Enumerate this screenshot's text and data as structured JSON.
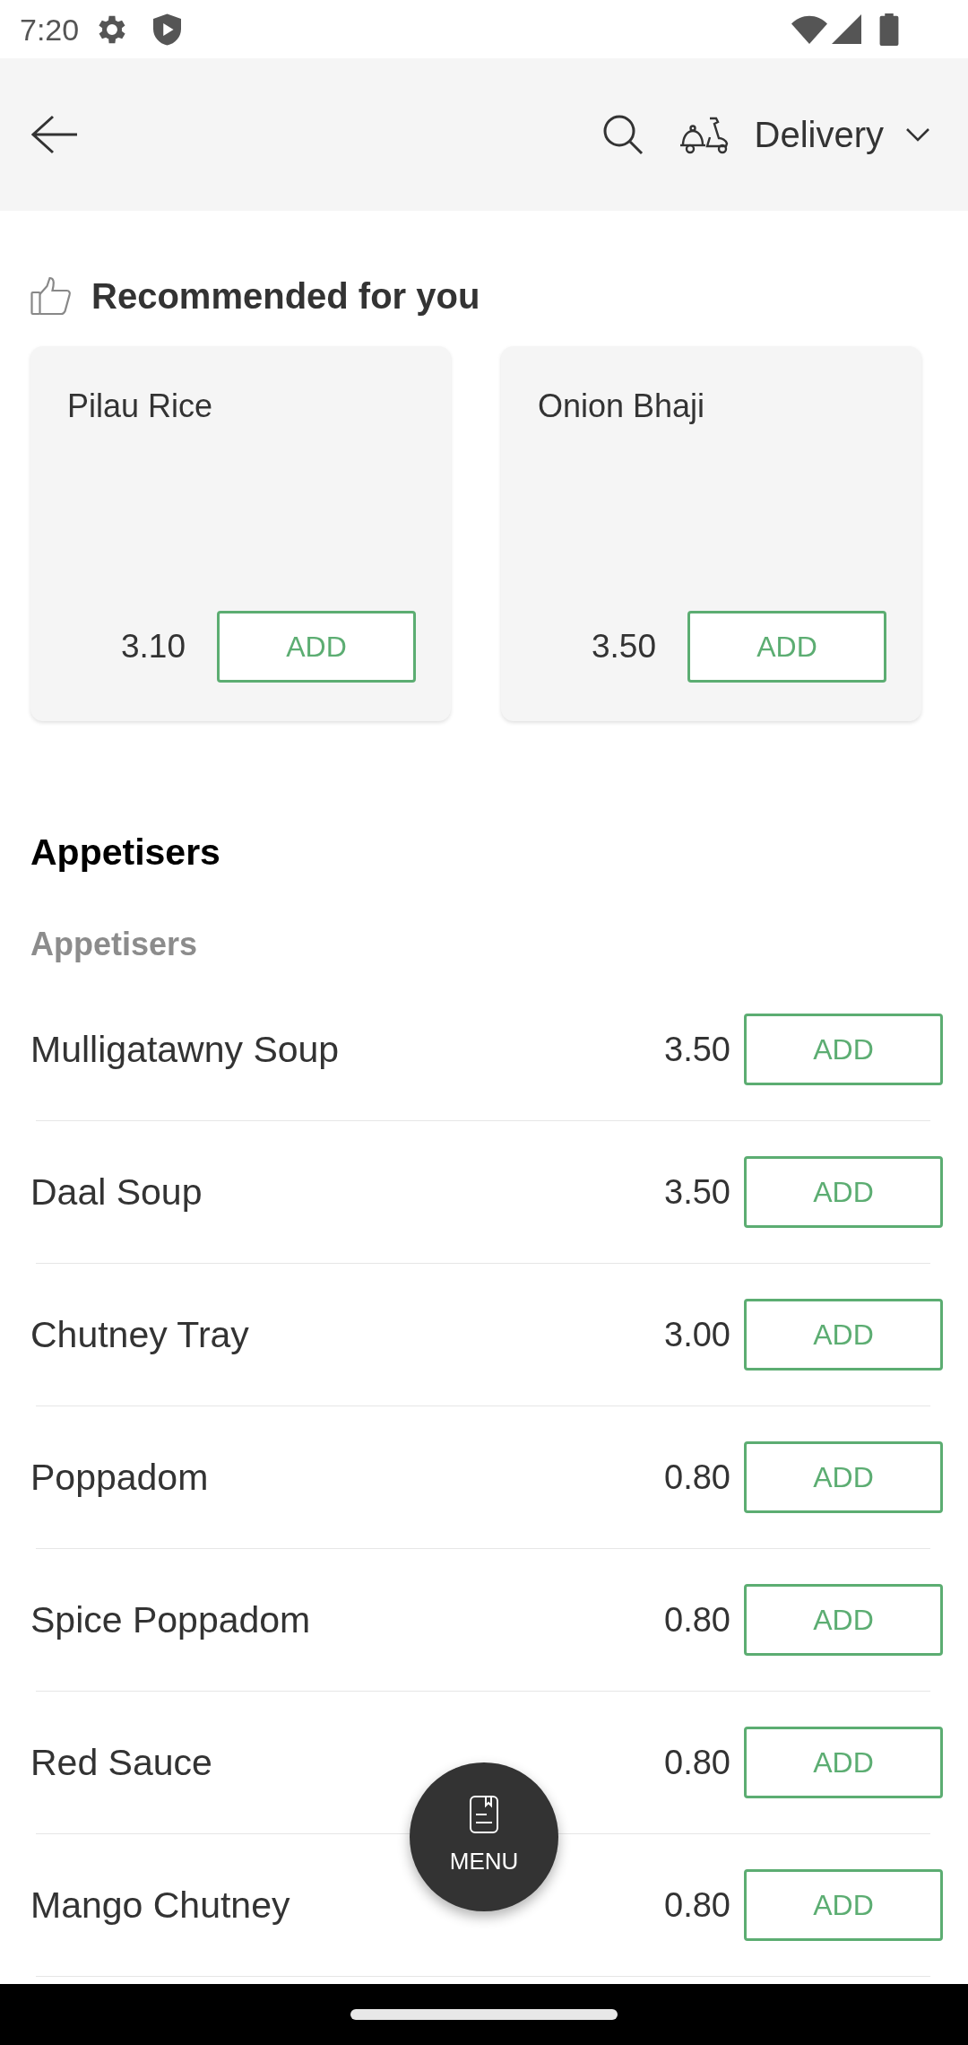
{
  "status_bar": {
    "time": "7:20"
  },
  "header": {
    "order_mode": "Delivery"
  },
  "recommended": {
    "title": "Recommended for you",
    "items": [
      {
        "name": "Pilau Rice",
        "price": "3.10",
        "button": "ADD"
      },
      {
        "name": "Onion Bhaji",
        "price": "3.50",
        "button": "ADD"
      }
    ]
  },
  "category": {
    "title": "Appetisers",
    "subtitle": "Appetisers",
    "items": [
      {
        "name": "Mulligatawny Soup",
        "price": "3.50",
        "button": "ADD"
      },
      {
        "name": "Daal Soup",
        "price": "3.50",
        "button": "ADD"
      },
      {
        "name": "Chutney Tray",
        "price": "3.00",
        "button": "ADD"
      },
      {
        "name": "Poppadom",
        "price": "0.80",
        "button": "ADD"
      },
      {
        "name": "Spice Poppadom",
        "price": "0.80",
        "button": "ADD"
      },
      {
        "name": "Red Sauce",
        "price": "0.80",
        "button": "ADD"
      },
      {
        "name": "Mango Chutney",
        "price": "0.80",
        "button": "ADD"
      }
    ]
  },
  "menu_button": {
    "label": "MENU"
  }
}
